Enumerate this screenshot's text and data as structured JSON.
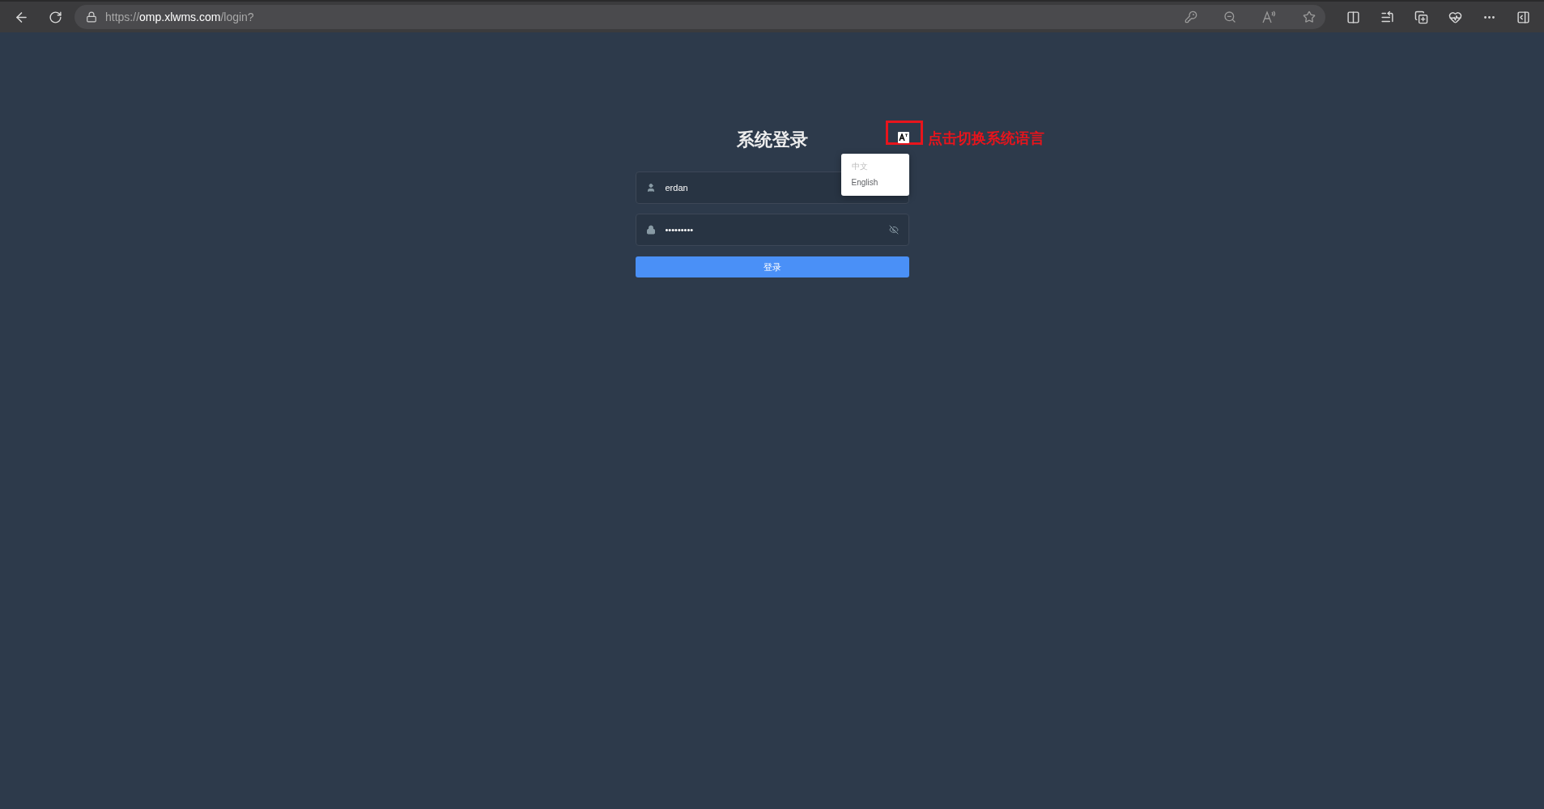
{
  "browser": {
    "url_scheme": "https://",
    "url_host": "omp.xlwms.com",
    "url_path": "/login?"
  },
  "login": {
    "title": "系统登录",
    "username": {
      "value": "erdan"
    },
    "password": {
      "value": "•••••••••"
    },
    "submit": "登录"
  },
  "language_menu": {
    "expanded": true,
    "items": [
      {
        "label": "中文",
        "selected": true
      },
      {
        "label": "English",
        "selected": false
      }
    ]
  },
  "annotation": {
    "text": "点击切换系统语言"
  }
}
